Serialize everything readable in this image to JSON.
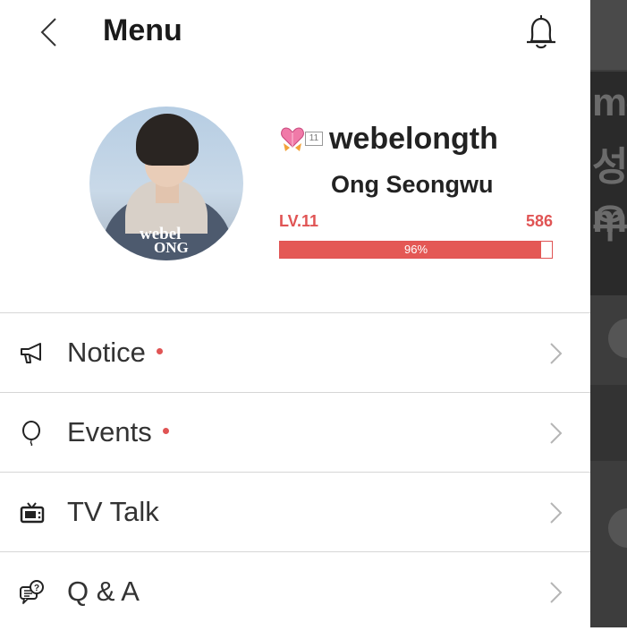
{
  "header": {
    "back_icon": "chevron-left-icon",
    "title": "Menu",
    "bell_icon": "bell-icon"
  },
  "profile": {
    "avatar_watermark_top": "webel",
    "avatar_watermark_bottom": "ONG",
    "badge_icon": "heart-ribbon-badge-icon",
    "badge_level": "11",
    "username": "webelongth",
    "real_name": "Ong Seongwu",
    "level_label": "LV.11",
    "points": "586",
    "progress_text": "96%",
    "progress_fraction": 0.96
  },
  "menu_items": [
    {
      "label": "Notice",
      "icon": "megaphone-icon",
      "has_new": true
    },
    {
      "label": "Events",
      "icon": "balloon-icon",
      "has_new": true
    },
    {
      "label": "TV Talk",
      "icon": "tv-icon",
      "has_new": false
    },
    {
      "label": "Q & A",
      "icon": "question-chat-icon",
      "has_new": false
    }
  ],
  "colors": {
    "accent": "#e05454",
    "progress_fill": "#e45855",
    "text": "#222222",
    "divider": "#d6d6d6",
    "overlay": "#3d3d3d"
  }
}
